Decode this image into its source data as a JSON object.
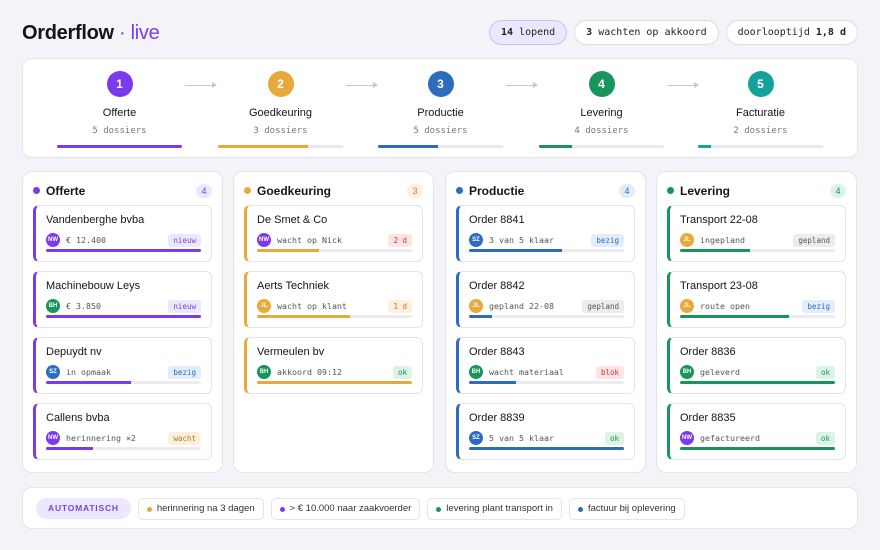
{
  "app": {
    "name": "Orderflow",
    "suffix": "· live",
    "accent": "#7c3aed"
  },
  "header": {
    "pills": [
      {
        "value": "14",
        "label": "lopend",
        "order": "value-first"
      },
      {
        "value": "3",
        "label": "wachten op akkoord",
        "order": "value-first"
      },
      {
        "value": "1,8 d",
        "label": "doorlooptijd",
        "order": "label-first"
      }
    ]
  },
  "pipeline": [
    {
      "num": "1",
      "name": "Offerte",
      "count": "5 dossiers",
      "color": "#7c3aed",
      "progress": 1.0
    },
    {
      "num": "2",
      "name": "Goedkeuring",
      "count": "3 dossiers",
      "color": "#e8a93a",
      "progress": 0.72
    },
    {
      "num": "3",
      "name": "Productie",
      "count": "5 dossiers",
      "color": "#2d6cbf",
      "progress": 0.48
    },
    {
      "num": "4",
      "name": "Levering",
      "count": "4 dossiers",
      "color": "#17955a",
      "progress": 0.26
    },
    {
      "num": "5",
      "name": "Facturatie",
      "count": "2 dossiers",
      "color": "#14a39a",
      "progress": 0.1
    }
  ],
  "columns": [
    {
      "title": "Offerte",
      "count": "4",
      "color": "#7c3aed",
      "count_bg": "#ede6ff",
      "count_fg": "#6d4bd8",
      "cards": [
        {
          "title": "Vandenberghe bvba",
          "avatar": "NW",
          "avatar_color": "#7c3aed",
          "sub": "€ 12.400",
          "tag": "nieuw",
          "tag_bg": "#ede6ff",
          "tag_fg": "#6d4bd8",
          "progress": 1.0
        },
        {
          "title": "Machinebouw Leys",
          "avatar": "BH",
          "avatar_color": "#17955a",
          "sub": "€ 3.850",
          "tag": "nieuw",
          "tag_bg": "#ede6ff",
          "tag_fg": "#6d4bd8",
          "progress": 1.0
        },
        {
          "title": "Depuydt nv",
          "avatar": "SZ",
          "avatar_color": "#2d6cbf",
          "sub": "in opmaak",
          "tag": "bezig",
          "tag_bg": "#e2edfb",
          "tag_fg": "#2d6cbf",
          "progress": 0.55
        },
        {
          "title": "Callens bvba",
          "avatar": "NW",
          "avatar_color": "#7c3aed",
          "sub": "herinnering ×2",
          "tag": "wacht",
          "tag_bg": "#fdf0dc",
          "tag_fg": "#b97a15",
          "progress": 0.3
        }
      ]
    },
    {
      "title": "Goedkeuring",
      "count": "3",
      "color": "#e8a93a",
      "count_bg": "#fdf0dc",
      "count_fg": "#c58820",
      "cards": [
        {
          "title": "De Smet & Co",
          "avatar": "NW",
          "avatar_color": "#7c3aed",
          "sub": "wacht op Nick",
          "tag": "2 d",
          "tag_bg": "#fde3e3",
          "tag_fg": "#c73636",
          "progress": 0.4
        },
        {
          "title": "Aerts Techniek",
          "avatar": "JL",
          "avatar_color": "#e8a93a",
          "sub": "wacht op klant",
          "tag": "1 d",
          "tag_bg": "#fdf0dc",
          "tag_fg": "#b97a15",
          "progress": 0.6
        },
        {
          "title": "Vermeulen bv",
          "avatar": "BH",
          "avatar_color": "#17955a",
          "sub": "akkoord 09:12",
          "tag": "ok",
          "tag_bg": "#ddf3e7",
          "tag_fg": "#17955a",
          "progress": 1.0
        }
      ]
    },
    {
      "title": "Productie",
      "count": "4",
      "color": "#2d6cbf",
      "count_bg": "#e2edfb",
      "count_fg": "#2d6cbf",
      "cards": [
        {
          "title": "Order 8841",
          "avatar": "SZ",
          "avatar_color": "#2d6cbf",
          "sub": "3 van 5 klaar",
          "tag": "bezig",
          "tag_bg": "#e2edfb",
          "tag_fg": "#2d6cbf",
          "progress": 0.6
        },
        {
          "title": "Order 8842",
          "avatar": "JL",
          "avatar_color": "#e8a93a",
          "sub": "gepland 22-08",
          "tag": "gepland",
          "tag_bg": "#ececf0",
          "tag_fg": "#555555",
          "progress": 0.15
        },
        {
          "title": "Order 8843",
          "avatar": "BH",
          "avatar_color": "#17955a",
          "sub": "wacht materiaal",
          "tag": "blok",
          "tag_bg": "#fde3e3",
          "tag_fg": "#c73636",
          "progress": 0.3
        },
        {
          "title": "Order 8839",
          "avatar": "SZ",
          "avatar_color": "#2d6cbf",
          "sub": "5 van 5 klaar",
          "tag": "ok",
          "tag_bg": "#ddf3e7",
          "tag_fg": "#17955a",
          "progress": 1.0
        }
      ]
    },
    {
      "title": "Levering",
      "count": "4",
      "color": "#17955a",
      "count_bg": "#ddf3e7",
      "count_fg": "#17955a",
      "cards": [
        {
          "title": "Transport 22-08",
          "avatar": "JL",
          "avatar_color": "#e8a93a",
          "sub": "ingepland",
          "tag": "gepland",
          "tag_bg": "#ececf0",
          "tag_fg": "#555555",
          "progress": 0.45
        },
        {
          "title": "Transport 23-08",
          "avatar": "JL",
          "avatar_color": "#e8a93a",
          "sub": "route open",
          "tag": "bezig",
          "tag_bg": "#e2edfb",
          "tag_fg": "#2d6cbf",
          "progress": 0.7
        },
        {
          "title": "Order 8836",
          "avatar": "BH",
          "avatar_color": "#17955a",
          "sub": "geleverd",
          "tag": "ok",
          "tag_bg": "#ddf3e7",
          "tag_fg": "#17955a",
          "progress": 1.0
        },
        {
          "title": "Order 8835",
          "avatar": "NW",
          "avatar_color": "#7c3aed",
          "sub": "gefactureerd",
          "tag": "ok",
          "tag_bg": "#ddf3e7",
          "tag_fg": "#17955a",
          "progress": 1.0
        }
      ]
    }
  ],
  "footer": {
    "label": "AUTOMATISCH",
    "rules": [
      {
        "text": "herinnering na 3 dagen",
        "color": "#e8a93a"
      },
      {
        "text": "> € 10.000 naar zaakvoerder",
        "color": "#7c3aed"
      },
      {
        "text": "levering plant transport in",
        "color": "#17955a"
      },
      {
        "text": "factuur bij oplevering",
        "color": "#2d6cbf"
      }
    ]
  }
}
